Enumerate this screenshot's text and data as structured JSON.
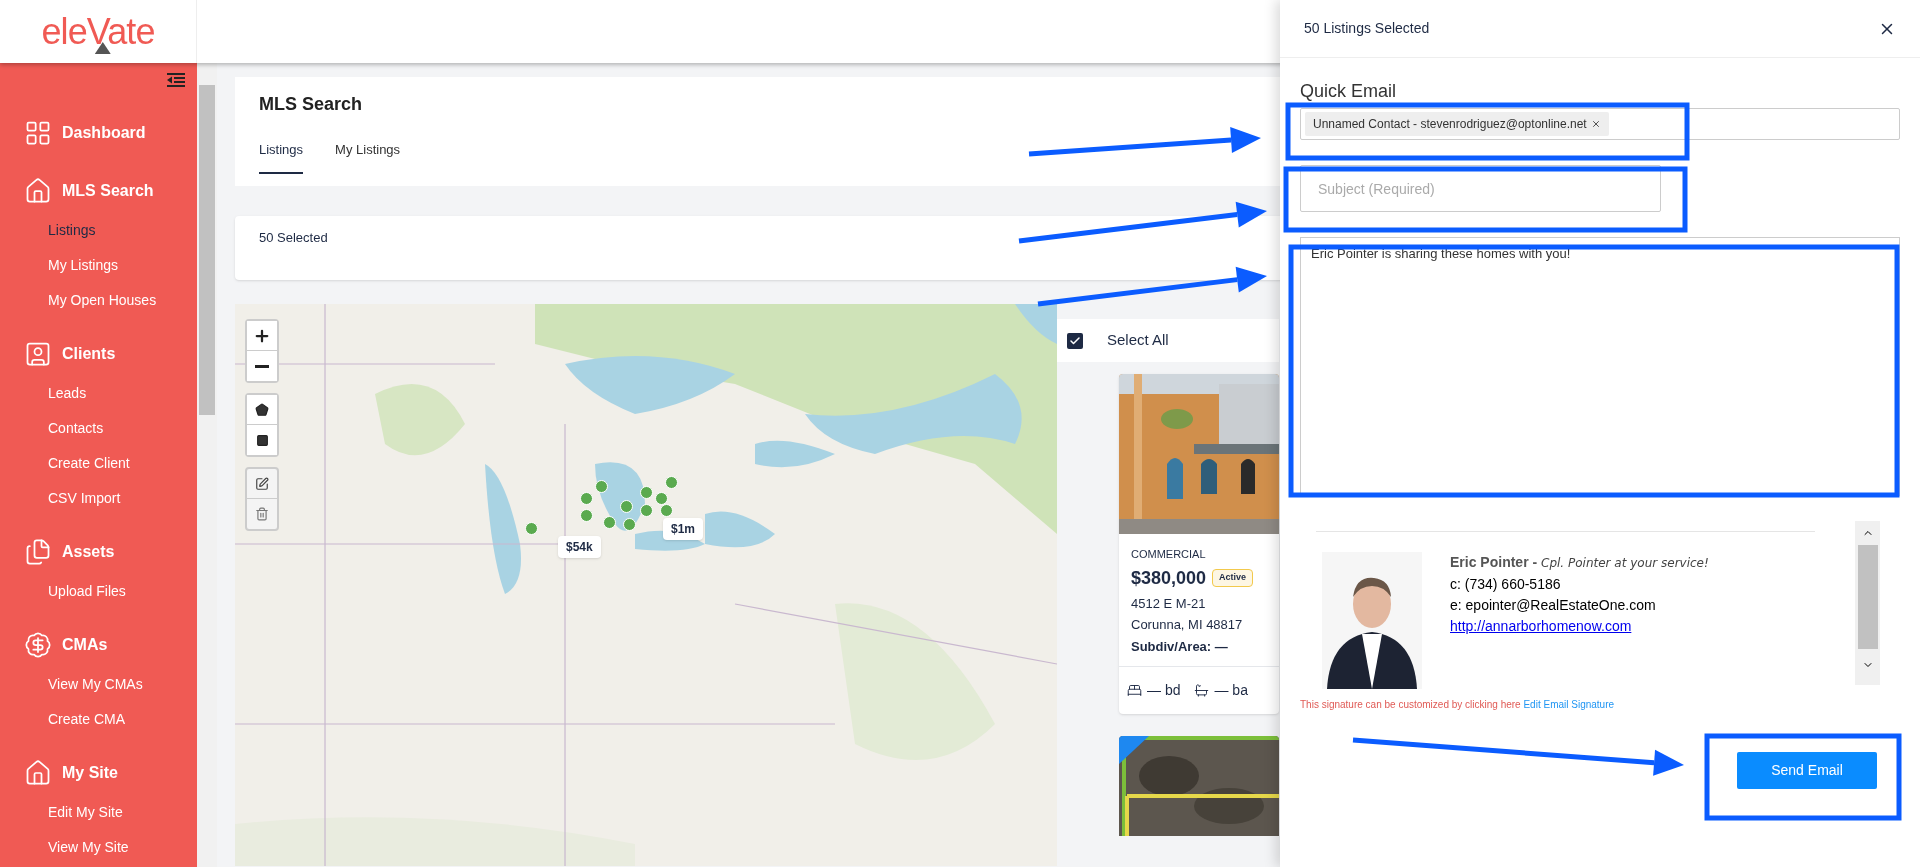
{
  "logo": {
    "text": "eleVate"
  },
  "sidebar": {
    "sections": [
      {
        "label": "Dashboard"
      },
      {
        "label": "MLS Search",
        "items": [
          {
            "label": "Listings",
            "selected": true
          },
          {
            "label": "My Listings",
            "selected": false
          },
          {
            "label": "My Open Houses",
            "selected": false
          }
        ]
      },
      {
        "label": "Clients",
        "items": [
          {
            "label": "Leads",
            "selected": false
          },
          {
            "label": "Contacts",
            "selected": false
          },
          {
            "label": "Create Client",
            "selected": false
          },
          {
            "label": "CSV Import",
            "selected": false
          }
        ]
      },
      {
        "label": "Assets",
        "items": [
          {
            "label": "Upload Files",
            "selected": false
          }
        ]
      },
      {
        "label": "CMAs",
        "items": [
          {
            "label": "View My CMAs",
            "selected": false
          },
          {
            "label": "Create CMA",
            "selected": false
          }
        ]
      },
      {
        "label": "My Site",
        "items": [
          {
            "label": "Edit My Site",
            "selected": false
          },
          {
            "label": "View My Site",
            "selected": false
          }
        ]
      }
    ]
  },
  "page": {
    "title": "MLS Search",
    "tabs": [
      {
        "label": "Listings",
        "selected": true
      },
      {
        "label": "My Listings",
        "selected": false
      }
    ]
  },
  "selection_bar": {
    "text": "50 Selected"
  },
  "map": {
    "markers": [
      {
        "label": "$54k"
      },
      {
        "label": "$1m"
      }
    ]
  },
  "listings": {
    "select_all": {
      "label": "Select All",
      "checked": true
    },
    "cards": [
      {
        "type": "COMMERCIAL",
        "price": "$380,000",
        "status": "Active",
        "address": "4512 E M-21",
        "city": "Corunna, MI 48817",
        "subdiv": "Subdiv/Area: —",
        "beds": "— bd",
        "baths": "— ba"
      }
    ]
  },
  "email_panel": {
    "title": "50 Listings Selected",
    "heading": "Quick Email",
    "recipients": [
      {
        "label": "Unnamed Contact - stevenrodriguez@optonline.net"
      }
    ],
    "subject": {
      "placeholder": "Subject (Required)"
    },
    "message": {
      "value": "Eric Pointer is sharing these homes with you!"
    },
    "signature": {
      "name": "Eric Pointer -",
      "tagline": "Cpl. Pointer at your service!",
      "phone": "c: (734) 660-5186",
      "email": "e: epointer@RealEstateOne.com",
      "website": "http://annarborhomenow.com"
    },
    "signature_note": {
      "text": "This signature can be customized by clicking here",
      "link": "Edit Email Signature"
    },
    "send_button": "Send Email"
  }
}
